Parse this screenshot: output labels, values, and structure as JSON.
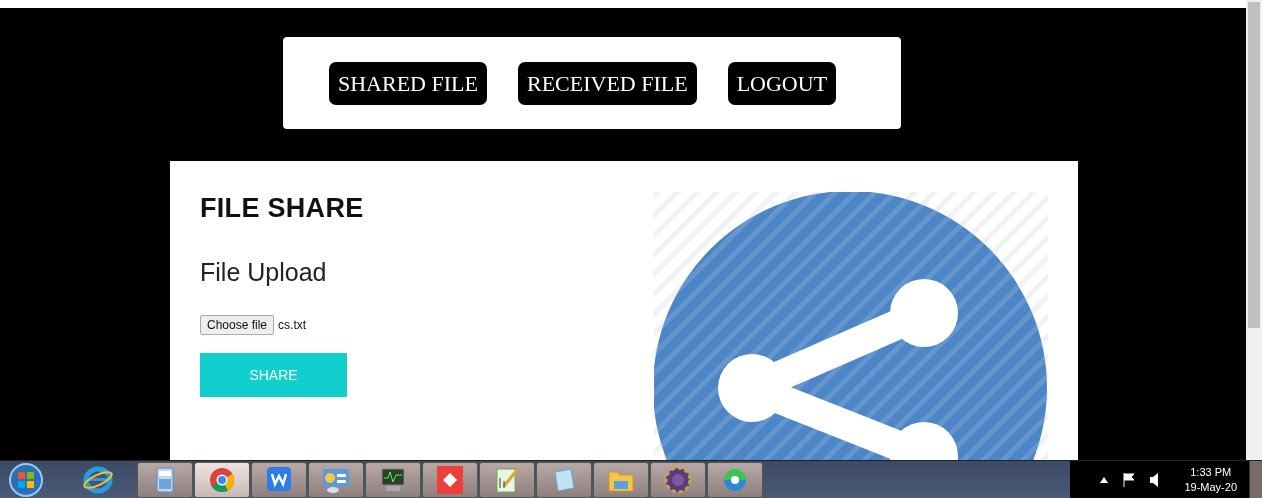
{
  "nav": {
    "buttons": [
      {
        "label": "SHARED FILE"
      },
      {
        "label": "RECEIVED FILE"
      },
      {
        "label": "LOGOUT"
      }
    ]
  },
  "card": {
    "title": "FILE SHARE",
    "subtitle": "File Upload",
    "file_input": {
      "button": "Choose file",
      "value": "cs.txt"
    },
    "submit": "SHARE"
  },
  "taskbar": {
    "apps": [
      {
        "kind": "browser-e",
        "selected": false
      },
      {
        "kind": "calculator",
        "selected": false
      },
      {
        "kind": "chrome",
        "selected": true
      },
      {
        "kind": "wps",
        "selected": false
      },
      {
        "kind": "panel",
        "selected": false
      },
      {
        "kind": "monitor",
        "selected": false
      },
      {
        "kind": "red",
        "selected": false
      },
      {
        "kind": "notepadpp",
        "selected": false
      },
      {
        "kind": "notepad",
        "selected": false
      },
      {
        "kind": "folder",
        "selected": false
      },
      {
        "kind": "gear",
        "selected": false
      },
      {
        "kind": "green",
        "selected": false
      }
    ],
    "time": "1:33 PM",
    "date": "19-May-20"
  }
}
